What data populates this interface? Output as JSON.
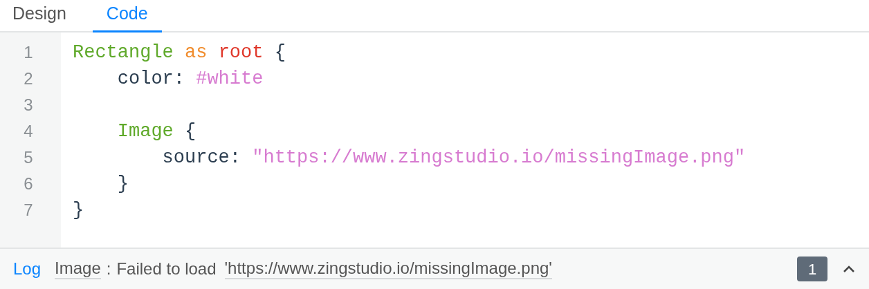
{
  "tabs": [
    {
      "label": "Design",
      "selected": false
    },
    {
      "label": "Code",
      "selected": true
    }
  ],
  "editor": {
    "lines": [
      {
        "number": "1",
        "tokens": [
          {
            "kind": "type",
            "text": "Rectangle"
          },
          {
            "kind": "keyword",
            "text": "as"
          },
          {
            "kind": "name",
            "text": "root"
          },
          {
            "kind": "punct",
            "text": "{"
          }
        ],
        "children": [
          {
            "number": "2",
            "tokens": [
              {
                "kind": "property",
                "text": "color:"
              },
              {
                "kind": "value",
                "text": "#white"
              }
            ]
          },
          {
            "number": "3"
          },
          {
            "number": "4",
            "tokens": [
              {
                "kind": "type",
                "text": "Image"
              },
              {
                "kind": "punct",
                "text": "{"
              }
            ],
            "children": [
              {
                "number": "5",
                "tokens": [
                  {
                    "kind": "property",
                    "text": "source:"
                  },
                  {
                    "kind": "value",
                    "text": "\"https://www.zingstudio.io/missingImage.png\""
                  }
                ]
              }
            ]
          },
          {
            "number": "6",
            "tokens": [
              {
                "kind": "punct",
                "text": "}"
              }
            ]
          }
        ]
      },
      {
        "number": "7",
        "tokens": [
          {
            "kind": "punct",
            "text": "}"
          }
        ]
      }
    ]
  },
  "log": {
    "label": "Log",
    "source": "Image",
    "separator": ":",
    "message": "Failed to load",
    "url": "'https://www.zingstudio.io/missingImage.png'",
    "count": "1",
    "expanded": false
  }
}
